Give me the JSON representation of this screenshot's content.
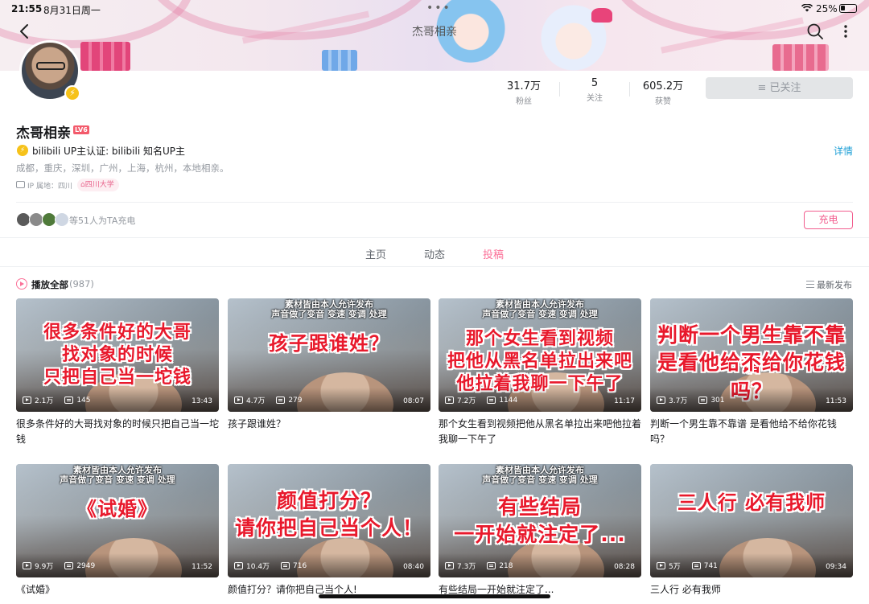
{
  "status": {
    "time": "21:55",
    "date": "8月31日周一",
    "battery": "25%"
  },
  "nav": {
    "title": "杰哥相亲"
  },
  "profile": {
    "name": "杰哥相亲",
    "level": "LV6",
    "stats": [
      {
        "value": "31.7万",
        "label": "粉丝"
      },
      {
        "value": "5",
        "label": "关注"
      },
      {
        "value": "605.2万",
        "label": "获赞"
      }
    ],
    "follow_label": "≡ 已关注",
    "verify": "bilibili UP主认证: bilibili 知名UP主",
    "detail_label": "详情",
    "bio": "成都，重庆，深圳，广州，上海，杭州，本地相亲。",
    "ip": "IP 属地：四川",
    "school": "四川大学"
  },
  "charge": {
    "text": "等51人为TA充电",
    "button": "充电"
  },
  "tabs": [
    {
      "label": "主页",
      "active": false
    },
    {
      "label": "动态",
      "active": false
    },
    {
      "label": "投稿",
      "active": true
    }
  ],
  "list": {
    "play_all": "播放全部",
    "count": "(987)",
    "sort": "最新发布"
  },
  "videos": [
    {
      "sub": "",
      "caption": [
        "很多条件好的大哥",
        "找对象的时候",
        "只把自己当一坨钱"
      ],
      "views": "2.1万",
      "danmaku": "145",
      "duration": "13:43",
      "title": "很多条件好的大哥找对象的时候只把自己当一坨钱"
    },
    {
      "sub": "素材皆由本人允许发布\n声音做了变音 变速 变调 处理",
      "caption": [
        "孩子跟谁姓？"
      ],
      "views": "4.7万",
      "danmaku": "279",
      "duration": "08:07",
      "title": "孩子跟谁姓？"
    },
    {
      "sub": "素材皆由本人允许发布\n声音做了变音 变速 变调 处理",
      "caption": [
        "那个女生看到视频",
        "把他从黑名单拉出来吧",
        "他拉着我聊一下午了"
      ],
      "views": "7.2万",
      "danmaku": "1144",
      "duration": "11:17",
      "title": "那个女生看到视频把他从黑名单拉出来吧他拉着我聊一下午了"
    },
    {
      "sub": "",
      "caption": [
        "判断一个男生靠不靠谱",
        "是看他给不给你花钱吗？"
      ],
      "views": "3.7万",
      "danmaku": "301",
      "duration": "11:53",
      "title": "判断一个男生靠不靠谱  是看他给不给你花钱吗？"
    },
    {
      "sub": "素材皆由本人允许发布\n声音做了变音 变速 变调 处理",
      "caption": [
        "《试婚》"
      ],
      "views": "9.9万",
      "danmaku": "2949",
      "duration": "11:52",
      "title": "《试婚》"
    },
    {
      "sub": "",
      "caption": [
        "颜值打分？",
        "请你把自己当个人！"
      ],
      "views": "10.4万",
      "danmaku": "716",
      "duration": "08:40",
      "title": "颜值打分？请你把自己当个人!"
    },
    {
      "sub": "素材皆由本人允许发布\n声音做了变音 变速 变调 处理",
      "caption": [
        "有些结局",
        "一开始就注定了..."
      ],
      "views": "7.3万",
      "danmaku": "218",
      "duration": "08:28",
      "title": "有些结局一开始就注定了..."
    },
    {
      "sub": "",
      "caption": [
        "三人行  必有我师"
      ],
      "views": "5万",
      "danmaku": "741",
      "duration": "09:34",
      "title": "三人行  必有我师"
    }
  ]
}
